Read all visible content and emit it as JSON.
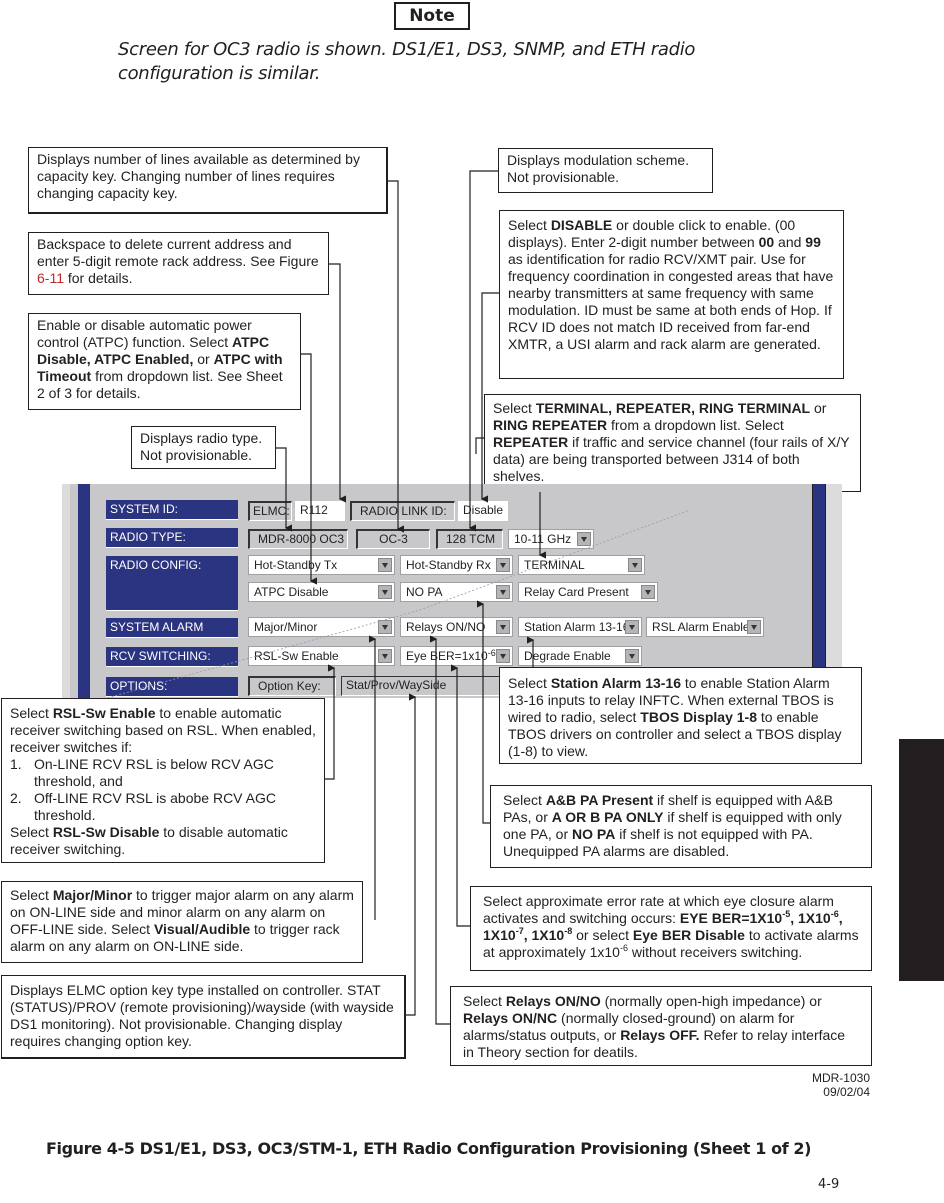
{
  "note": {
    "badge": "Note",
    "text": "Screen for OC3 radio is shown. DS1/E1, DS3, SNMP, and ETH radio configuration is similar."
  },
  "callouts": {
    "lines_available": "Displays number of lines available as determined by capacity key. Changing number of lines requires changing capacity key.",
    "backspace": {
      "pre": "Backspace to delete current address and enter 5-digit remote rack address. See Figure ",
      "link": "6-11",
      "post": " for details."
    },
    "atpc": {
      "t1": "Enable or disable automatic power control (ATPC) function. Select ",
      "b1": "ATPC Disable, ATPC Enabled,",
      "t2": " or ",
      "b2": "ATPC with Timeout",
      "t3": " from dropdown list. See Sheet 2 of 3 for details."
    },
    "radio_type": "Displays radio type. Not provisionable.",
    "modulation": "Displays modulation scheme. Not provisionable.",
    "link_id": {
      "t1": "Select ",
      "b1": "DISABLE",
      "t2": " or double click to enable. (00 displays). Enter 2-digit number between ",
      "b2": "00",
      "t3": " and ",
      "b3": "99",
      "t4": " as  identification for radio RCV/XMT pair. Use for frequency coordination in congested areas that have nearby transmitters at same frequency with same modulation. ID must be same at both ends of Hop. If RCV ID does not match ID received from far-end XMTR, a USI alarm and rack alarm are generated."
    },
    "terminal": {
      "t1": "Select ",
      "b1": "TERMINAL, REPEATER, RING TERMINAL",
      "t2": " or ",
      "b2": "RING REPEATER",
      "t3": " from a dropdown list. Select ",
      "b3": "REPEATER",
      "t4": " if traffic and service channel (four rails of X/Y data) are being transported between J314 of both shelves."
    },
    "station_alarm": {
      "t1": "Select ",
      "b1": "Station Alarm 13-16",
      "t2": " to enable Station Alarm 13-16 inputs to relay INFTC. When external TBOS is wired to radio, select ",
      "b2": "TBOS Display 1-8",
      "t3": " to enable TBOS drivers on controller and select a TBOS display (1-8) to view."
    },
    "rsl_sw": {
      "t1": "Select ",
      "b1": "RSL-Sw Enable",
      "t2": " to enable automatic receiver switching based on RSL. When enabled, receiver switches if:",
      "items": [
        {
          "num": "1.",
          "text": "On-LINE RCV RSL is below RCV AGC threshold, and"
        },
        {
          "num": "2.",
          "text": "Off-LINE RCV RSL is abobe RCV AGC threshold."
        }
      ],
      "t3": "Select ",
      "b3": "RSL-Sw Disable",
      "t4": " to disable automatic receiver switching."
    },
    "pa": {
      "t1": "Select ",
      "b1": "A&B PA Present",
      "t2": " if shelf is equipped with A&B PAs, or ",
      "b2": "A OR B PA ONLY",
      "t3": " if shelf is equipped with only one PA, or ",
      "b3": "NO PA",
      "t4": " if shelf is not equipped with PA. Unequipped PA alarms are disabled."
    },
    "major_minor": {
      "t1": "Select ",
      "b1": "Major/Minor",
      "t2": " to trigger  major alarm on any alarm on ON-LINE side and minor alarm on any alarm on OFF-LINE side. Select ",
      "b2": "Visual/Audible",
      "t3": " to trigger rack alarm on any alarm on ON-LINE side."
    },
    "eye_ber": {
      "t1": "Select approximate error rate at which eye closure alarm activates and switching occurs: ",
      "b1": "EYE BER=1X10",
      "s1": "-5",
      "b2": ", 1X10",
      "s2": "-6",
      "b3": ", 1X10",
      "s3": "-7",
      "b4": ", 1X10",
      "s4": "-8",
      "t2": " or select ",
      "b5": "Eye BER Disable",
      "t3": "  to activate alarms at approximately 1x10",
      "s5": "-6",
      "t4": "  without receivers switching."
    },
    "option_key": "Displays ELMC option key type installed on controller. STAT (STATUS)/PROV (remote provisioning)/wayside (with wayside DS1 monitoring). Not provisionable. Changing display requires changing option key.",
    "relays": {
      "t1": "Select ",
      "b1": "Relays ON/NO",
      "t2": " (normally open-high impedance) or ",
      "b2": "Relays ON/NC",
      "t3": " (normally closed-ground) on alarm for alarms/status outputs, or ",
      "b3": "Relays OFF.",
      "t4": " Refer to relay interface in Theory section for deatils."
    }
  },
  "panel": {
    "labels": {
      "system_id": "SYSTEM ID:",
      "radio_type": "RADIO TYPE:",
      "radio_config": "RADIO CONFIG:",
      "system_alarm": "SYSTEM ALARM",
      "rcv_switching": "RCV  SWITCHING:",
      "options": "OPTIONS:"
    },
    "system_id": {
      "elmc_label": "ELMC:",
      "elmc_value": "R112",
      "link_id_label": "RADIO LINK ID:",
      "link_id_value": "Disable"
    },
    "radio_type": {
      "model": "MDR-8000 OC3",
      "capacity": "OC-3",
      "modulation": "128 TCM",
      "band": "10-11 GHz"
    },
    "radio_config": {
      "tx": "Hot-Standby Tx",
      "rx": "Hot-Standby Rx",
      "mode": "TERMINAL",
      "atpc": "ATPC Disable",
      "pa": "NO PA",
      "relay": "Relay Card Present"
    },
    "system_alarm": {
      "alarm_type": "Major/Minor",
      "relays": "Relays ON/NO",
      "station_alarm": "Station Alarm 13-16",
      "rsl_alarm": "RSL Alarm Enable"
    },
    "rcv_switching": {
      "rsl_sw": "RSL-Sw Enable",
      "eye_ber_base": "Eye BER=1x10",
      "eye_ber_exp": "-6",
      "degrade": "Degrade Enable"
    },
    "options": {
      "key_label": "Option Key:",
      "key_value": "Stat/Prov/WaySide"
    }
  },
  "footer": {
    "doc_id": "MDR-1030",
    "date": "09/02/04",
    "caption": "Figure 4-5  DS1/E1, DS3, OC3/STM-1, ETH Radio Configuration Provisioning (Sheet 1 of 2)",
    "page": "4-9"
  }
}
